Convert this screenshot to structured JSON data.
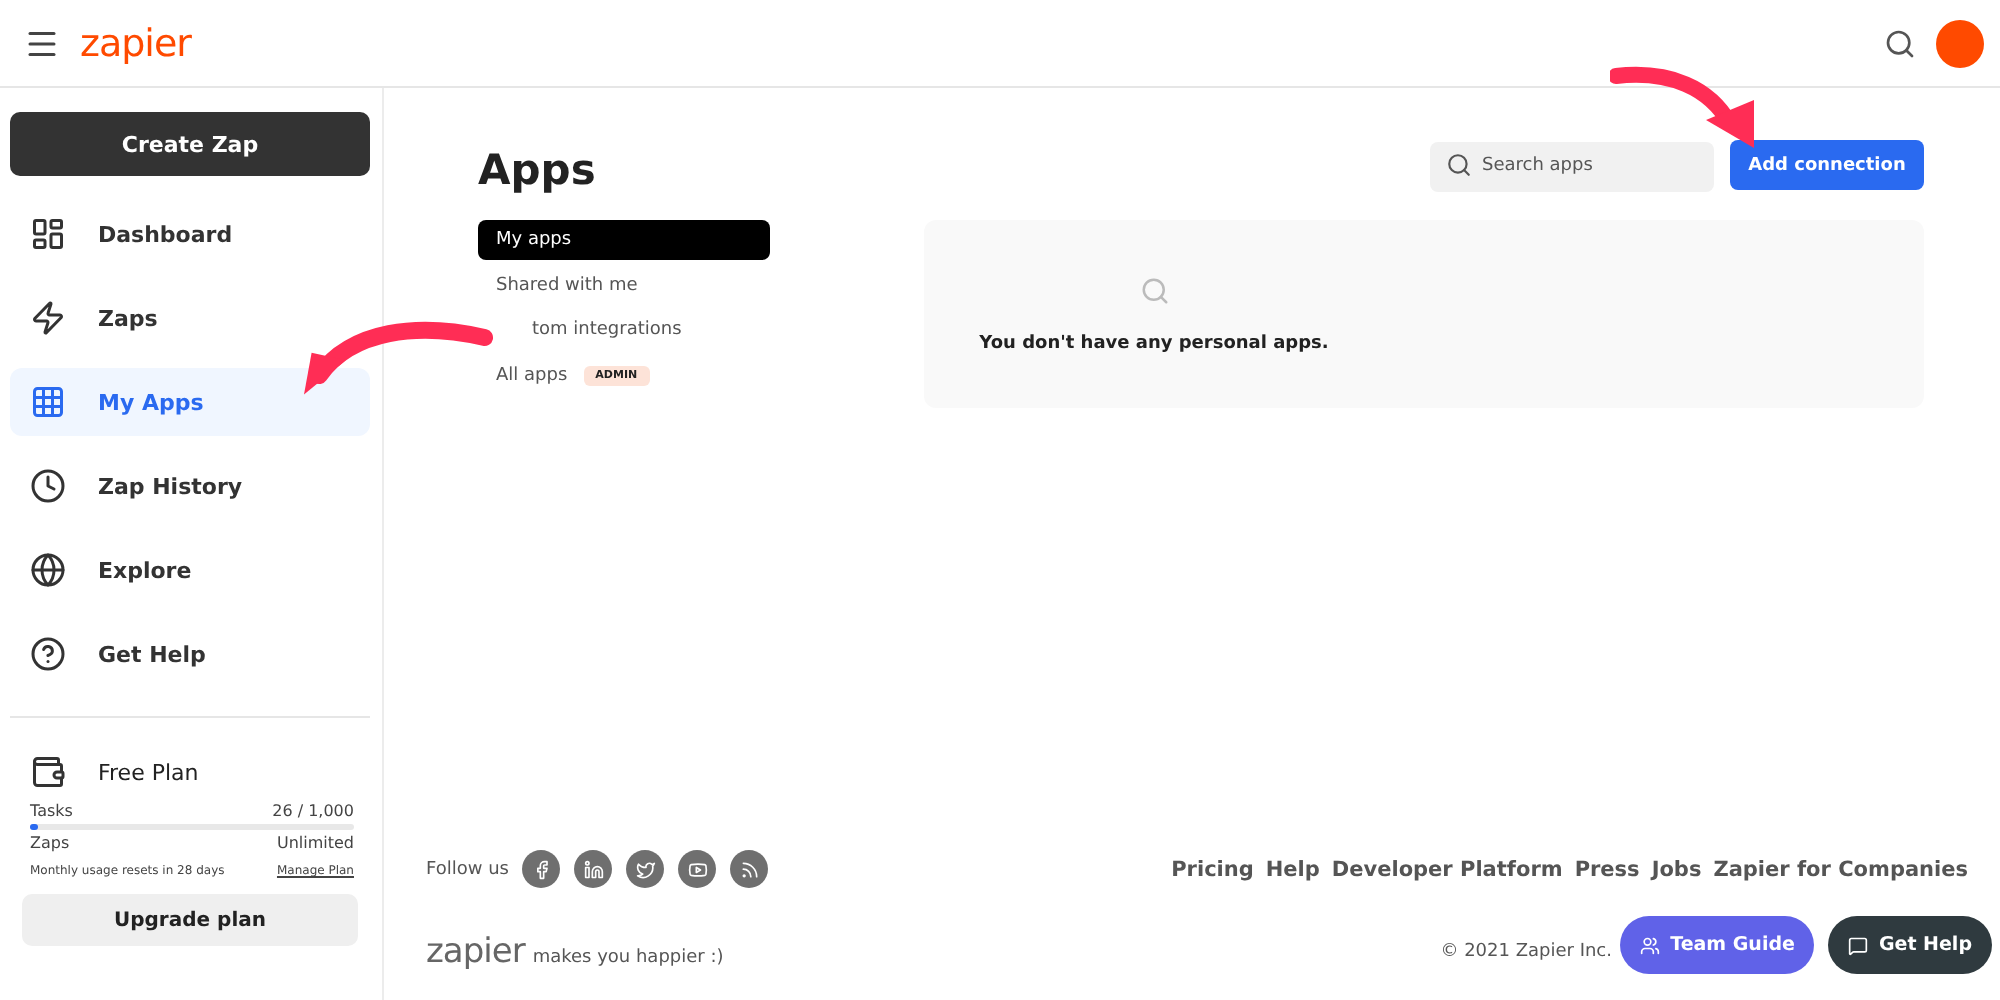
{
  "header": {
    "logo": "zapier"
  },
  "sidebar": {
    "create_button": "Create Zap",
    "items": [
      {
        "label": "Dashboard",
        "selected": false
      },
      {
        "label": "Zaps",
        "selected": false
      },
      {
        "label": "My Apps",
        "selected": true
      },
      {
        "label": "Zap History",
        "selected": false
      },
      {
        "label": "Explore",
        "selected": false
      },
      {
        "label": "Get Help",
        "selected": false
      }
    ],
    "plan": {
      "title": "Free Plan",
      "tasks_label": "Tasks",
      "tasks_value": "26 / 1,000",
      "level": 0.026,
      "zaps_label": "Zaps",
      "zaps_value": "Unlimited",
      "reset_note": "Monthly usage resets in 28 days",
      "manage_link": "Manage Plan",
      "upgrade_button": "Upgrade plan"
    }
  },
  "page": {
    "title": "Apps",
    "subnav": [
      {
        "label": "My apps",
        "selected": true
      },
      {
        "label": "Shared with me",
        "selected": false
      },
      {
        "label": "tom integrations",
        "selected": false
      },
      {
        "label": "All apps",
        "selected": false,
        "badge": "ADMIN"
      }
    ],
    "search": {
      "placeholder": "Search apps"
    },
    "add_button": "Add connection",
    "empty_message": "You don't have any personal apps."
  },
  "footer": {
    "follow_label": "Follow us",
    "links": [
      "Pricing",
      "Help",
      "Developer Platform",
      "Press",
      "Jobs",
      "Zapier for Companies"
    ],
    "logo": "zapier",
    "tagline": "makes you happier :)",
    "copyright": "© 2021 Zapier Inc."
  },
  "floating": {
    "team_guide": "Team Guide",
    "get_help": "Get Help"
  }
}
